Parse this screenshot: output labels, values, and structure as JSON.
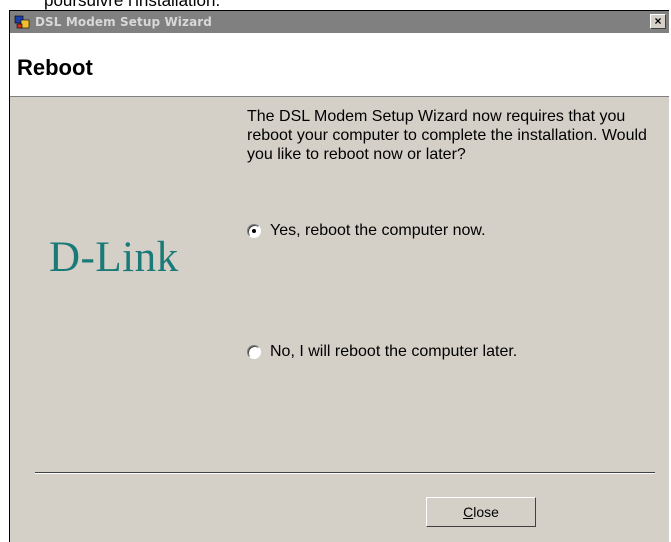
{
  "document": {
    "fragment_text": "poursuivre l'installation."
  },
  "window": {
    "title": "DSL Modem Setup Wizard",
    "close_glyph": "×"
  },
  "header": {
    "title": "Reboot"
  },
  "logo": {
    "text": "D-Link"
  },
  "message": "The DSL Modem Setup Wizard now requires that you reboot your computer to complete the installation.  Would you like to reboot now or later?",
  "options": [
    {
      "label": "Yes, reboot the computer now.",
      "selected": true
    },
    {
      "label": "No, I will reboot the computer later.",
      "selected": false
    }
  ],
  "buttons": {
    "close_mnemonic": "C",
    "close_rest": "lose"
  },
  "colors": {
    "logo": "#1a7a78",
    "dialog_bg": "#d4d0c8",
    "titlebar_inactive": "#808080"
  }
}
